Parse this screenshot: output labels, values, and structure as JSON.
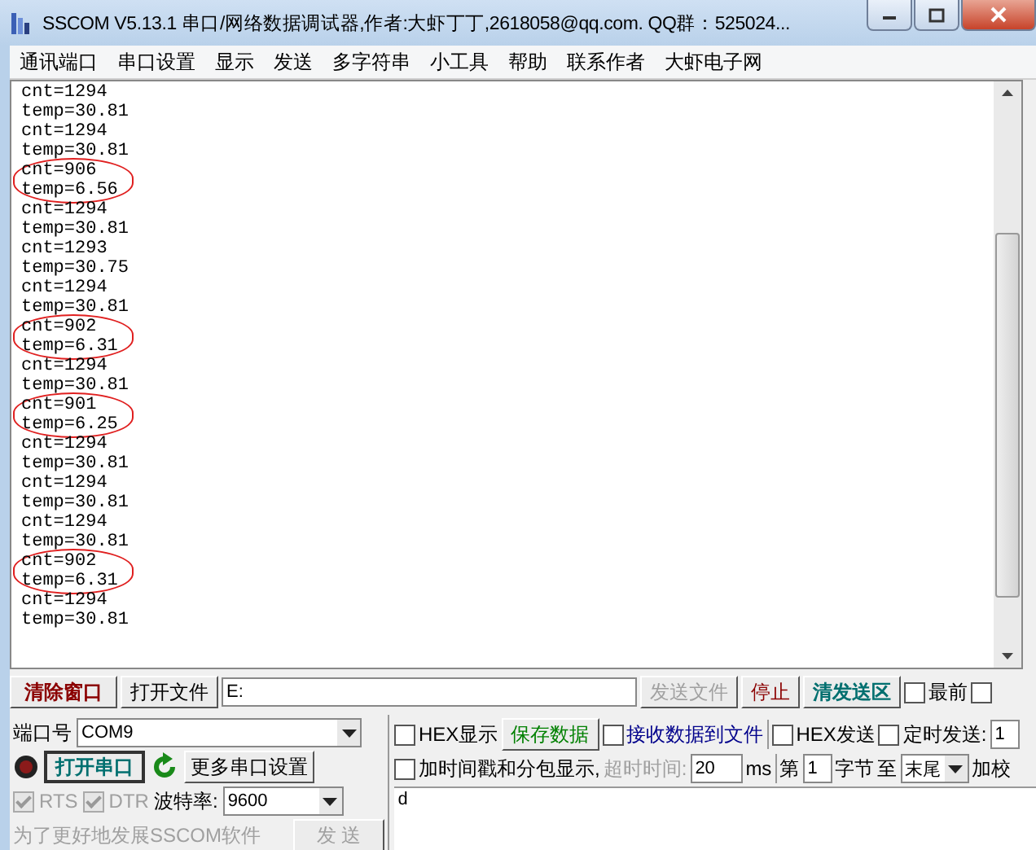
{
  "window": {
    "title": "SSCOM V5.13.1 串口/网络数据调试器,作者:大虾丁丁,2618058@qq.com. QQ群：525024..."
  },
  "menu": [
    "通讯端口",
    "串口设置",
    "显示",
    "发送",
    "多字符串",
    "小工具",
    "帮助",
    "联系作者",
    "大虾电子网"
  ],
  "log": {
    "entries": [
      {
        "cnt": "cnt=1294",
        "temp": "temp=30.81",
        "circled": false
      },
      {
        "cnt": "cnt=1294",
        "temp": "temp=30.81",
        "circled": false
      },
      {
        "cnt": "cnt=906",
        "temp": "temp=6.56",
        "circled": true
      },
      {
        "cnt": "cnt=1294",
        "temp": "temp=30.81",
        "circled": false
      },
      {
        "cnt": "cnt=1293",
        "temp": "temp=30.75",
        "circled": false
      },
      {
        "cnt": "cnt=1294",
        "temp": "temp=30.81",
        "circled": false
      },
      {
        "cnt": "cnt=902",
        "temp": "temp=6.31",
        "circled": true
      },
      {
        "cnt": "cnt=1294",
        "temp": "temp=30.81",
        "circled": false
      },
      {
        "cnt": "cnt=901",
        "temp": "temp=6.25",
        "circled": true
      },
      {
        "cnt": "cnt=1294",
        "temp": "temp=30.81",
        "circled": false
      },
      {
        "cnt": "cnt=1294",
        "temp": "temp=30.81",
        "circled": false
      },
      {
        "cnt": "cnt=1294",
        "temp": "temp=30.81",
        "circled": false
      },
      {
        "cnt": "cnt=902",
        "temp": "temp=6.31",
        "circled": true
      },
      {
        "cnt": "cnt=1294",
        "temp": "temp=30.81",
        "circled": false
      }
    ]
  },
  "toolbar": {
    "clear_window": "清除窗口",
    "open_file": "打开文件",
    "file_path": "E:",
    "send_file": {
      "label": "发送文件",
      "disabled": true
    },
    "stop": "停止",
    "clear_send": "清发送区",
    "on_top": {
      "label": "最前",
      "checked": false
    },
    "extra_checkbox": {
      "checked": false
    }
  },
  "port": {
    "label": "端口号",
    "value": "COM9",
    "led_on": false,
    "open_button": "打开串口",
    "more_settings": "更多串口设置",
    "rts": {
      "label": "RTS",
      "checked": true,
      "disabled": true
    },
    "dtr": {
      "label": "DTR",
      "checked": true,
      "disabled": true
    },
    "baud_label": "波特率:",
    "baud_value": "9600",
    "notice": "为了更好地发展SSCOM软件",
    "send_button": {
      "label": "发 送",
      "disabled": true
    }
  },
  "options": {
    "hex_display": {
      "label": "HEX显示",
      "checked": false
    },
    "save_data": "保存数据",
    "receive_to_file": {
      "label": "接收数据到文件",
      "checked": false
    },
    "hex_send": {
      "label": "HEX发送",
      "checked": false
    },
    "timed_send": {
      "label": "定时发送:",
      "checked": false
    },
    "timed_value": "1",
    "timestamp": {
      "label": "加时间戳和分包显示,",
      "checked": false
    },
    "timeout_label": "超时时间:",
    "timeout_value": "20",
    "timeout_unit": "ms",
    "byte_from_label": "第",
    "byte_from": "1",
    "byte_unit": "字节",
    "byte_to_label": "至",
    "byte_to": "末尾",
    "checksum_label": "加校"
  },
  "send_area": {
    "value": "d"
  }
}
